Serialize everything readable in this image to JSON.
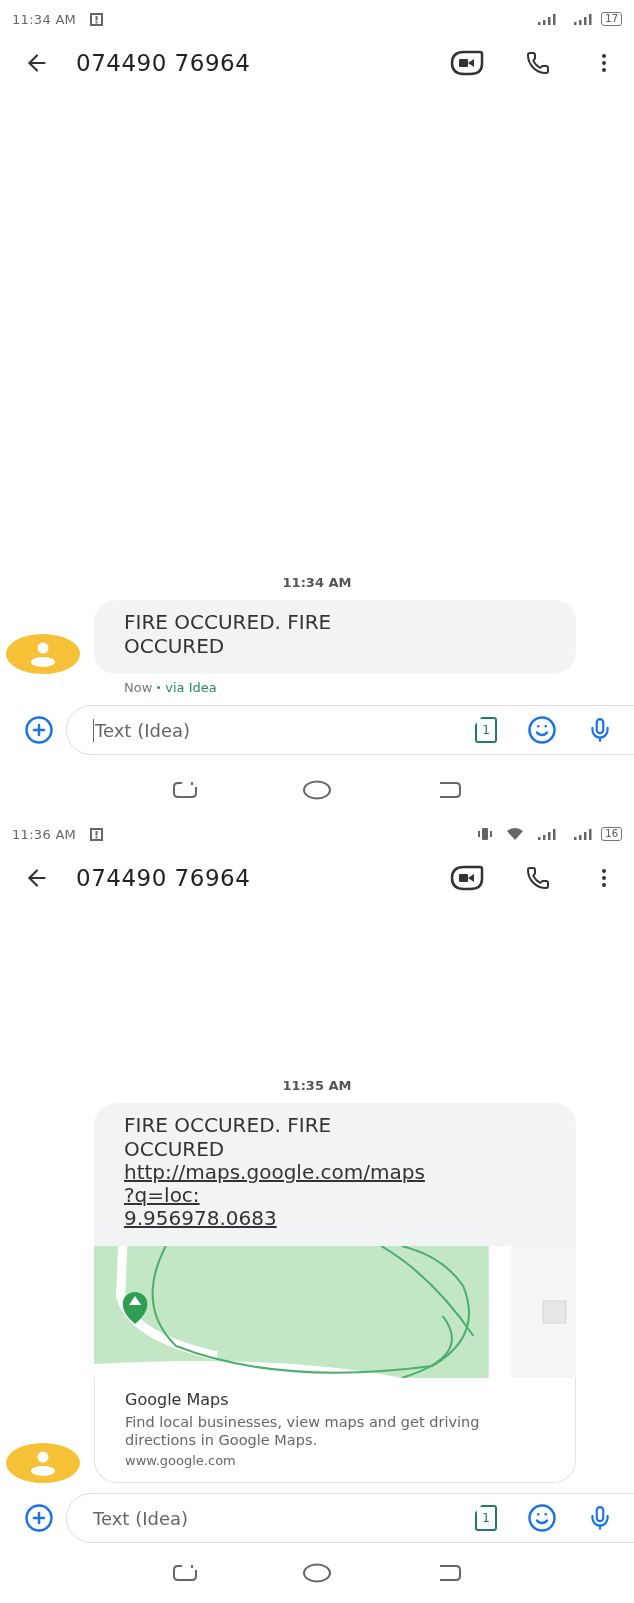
{
  "screens": [
    {
      "status_bar": {
        "time": "11:34 AM",
        "battery": "17",
        "vibrate": false,
        "wifi": false
      },
      "header": {
        "title": "074490 76964"
      },
      "timestamp": "11:34 AM",
      "message": {
        "kind": "text",
        "lines": [
          "FIRE OCCURED. FIRE OCCURED"
        ],
        "meta": "Now",
        "via": "via Idea"
      },
      "composer": {
        "placeholder": "Text (Idea)",
        "sim": "1",
        "focused": true
      }
    },
    {
      "status_bar": {
        "time": "11:36 AM",
        "battery": "16",
        "vibrate": true,
        "wifi": true
      },
      "header": {
        "title": "074490 76964"
      },
      "timestamp": "11:35 AM",
      "message": {
        "kind": "link_preview",
        "lines": [
          "FIRE OCCURED. FIRE OCCURED"
        ],
        "link_lines": [
          "http://maps.google.com/maps",
          "?q=loc:",
          "9.956978.0683"
        ],
        "preview": {
          "kind": "picture",
          "site": "Google Maps",
          "description": "Find local businesses, view maps and get driving directions in Google Maps.",
          "domain": "www.google.com"
        }
      },
      "composer": {
        "placeholder": "Text (Idea)",
        "sim": "1",
        "focused": false
      }
    }
  ]
}
